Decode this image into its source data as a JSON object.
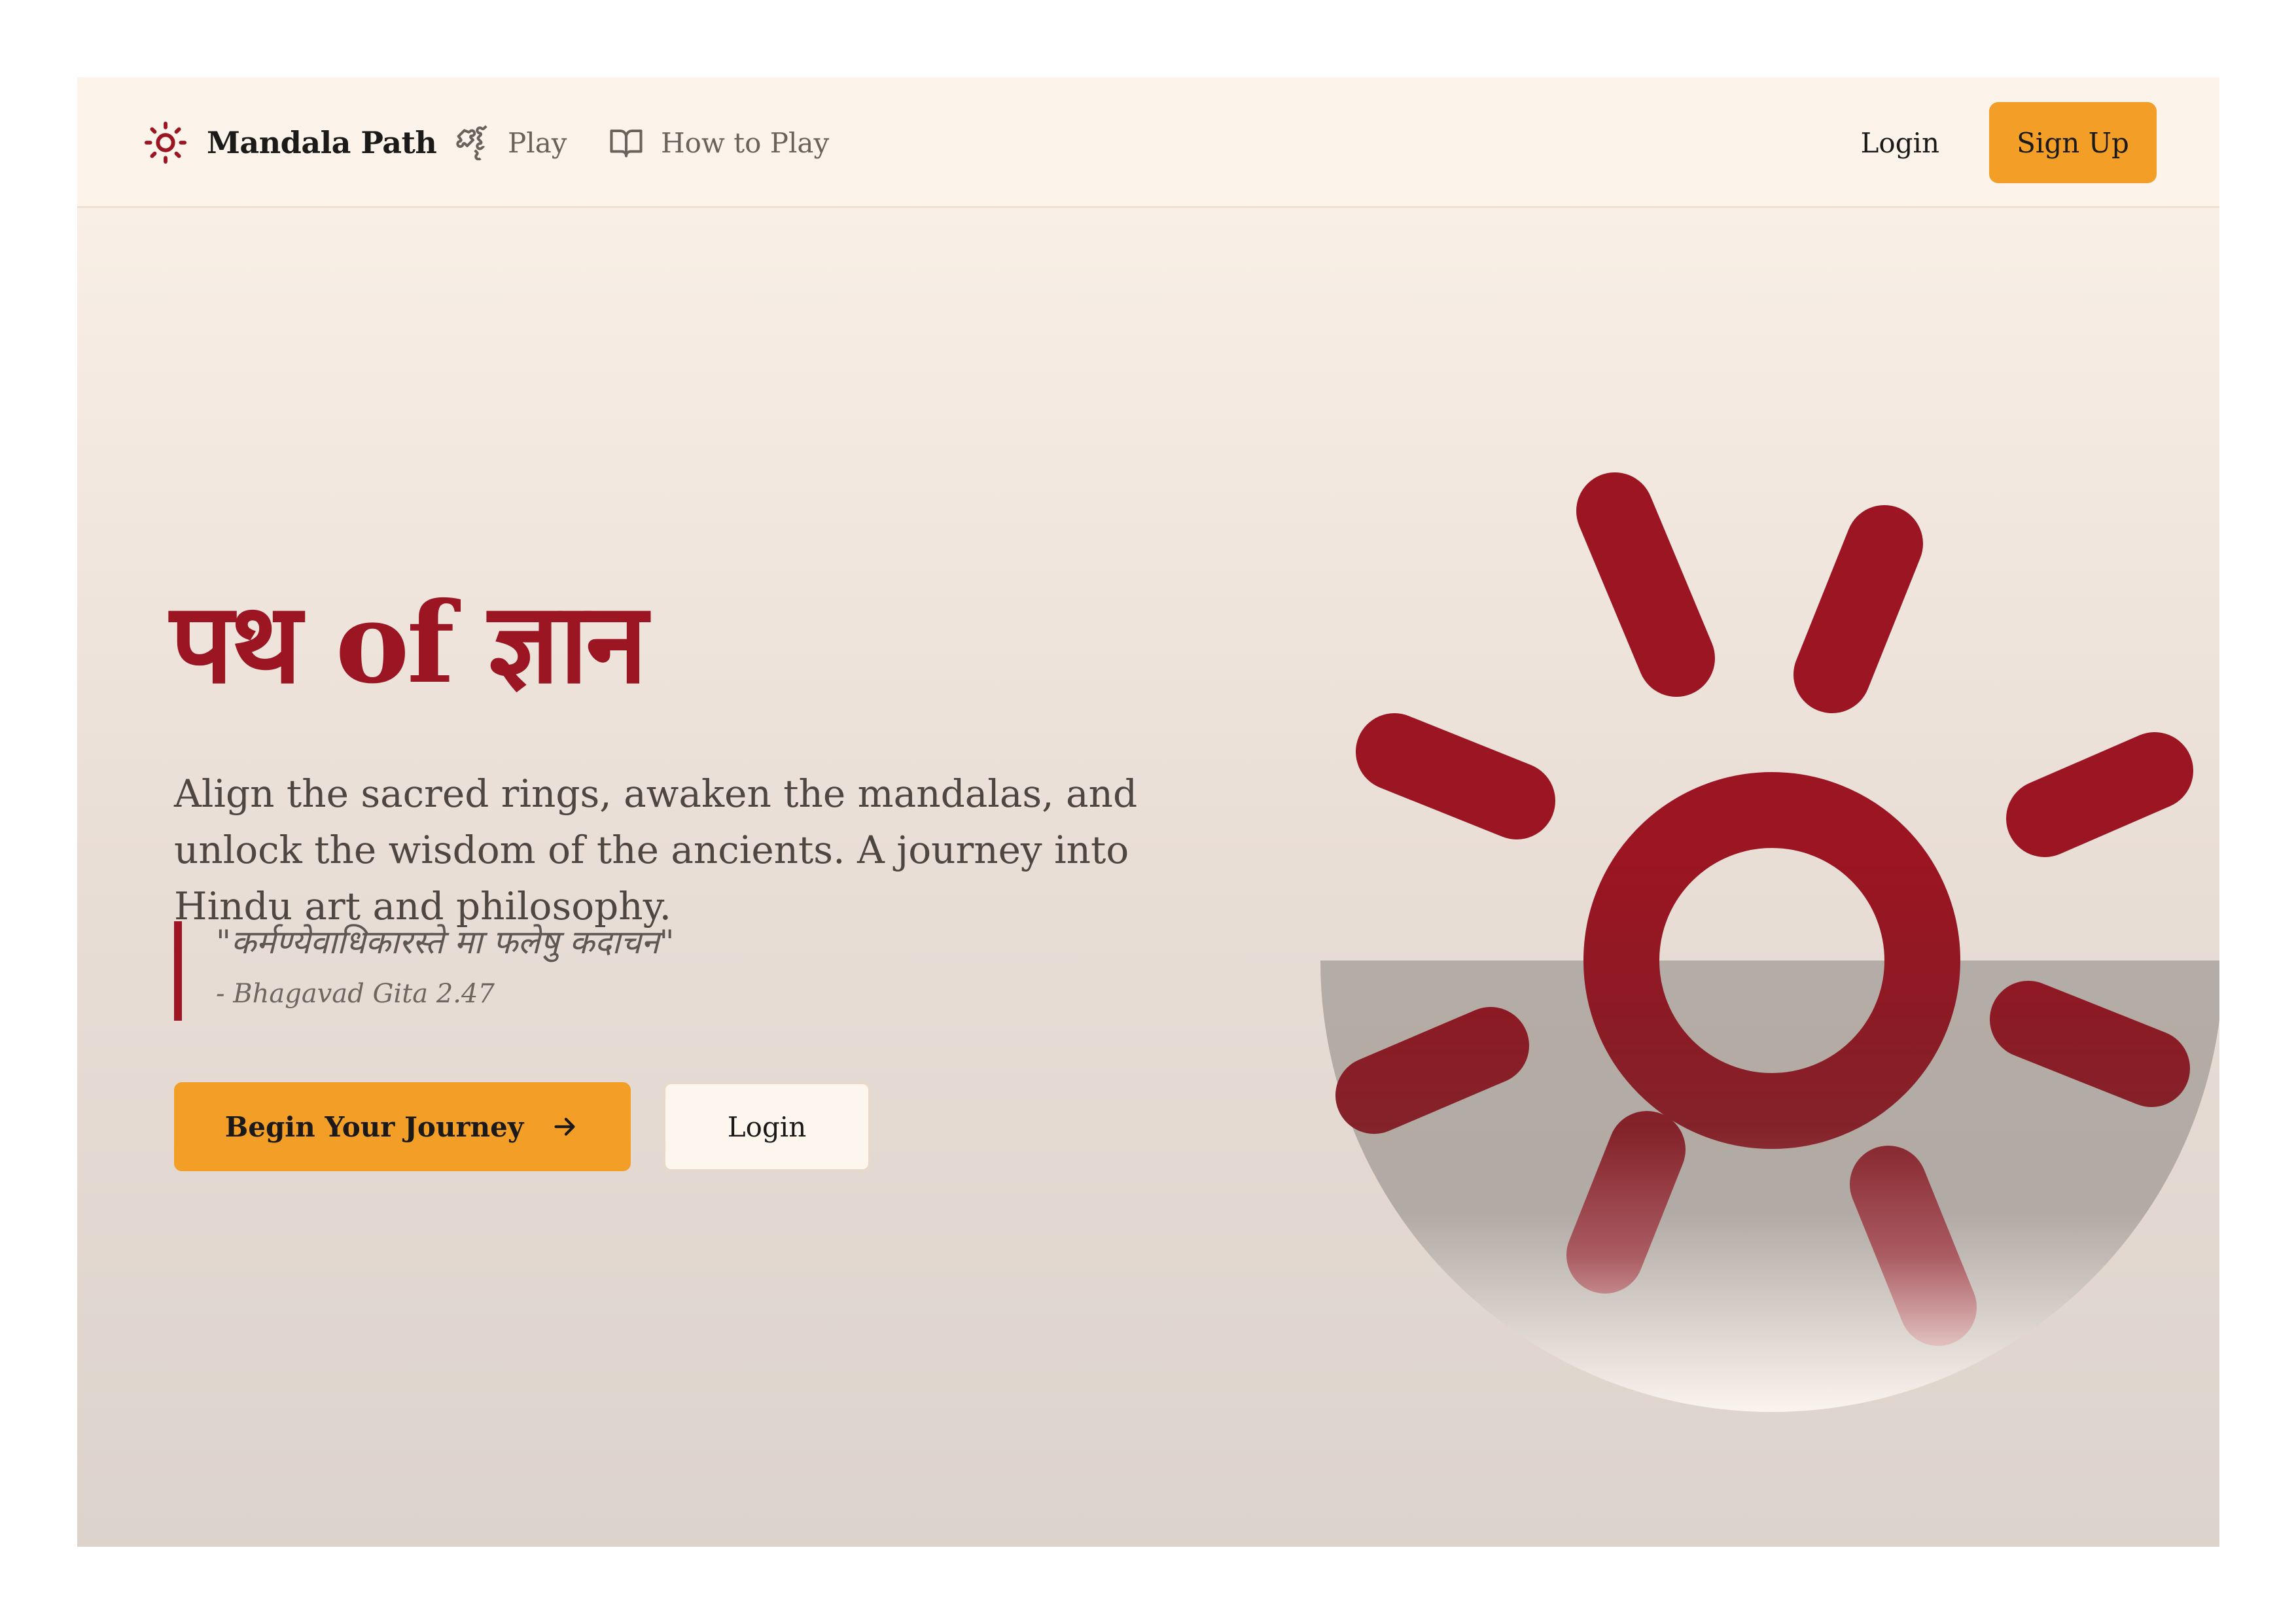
{
  "nav": {
    "brand": "Mandala Path",
    "links": [
      {
        "label": "Play",
        "icon": "puzzle-icon"
      },
      {
        "label": "How to Play",
        "icon": "book-icon"
      }
    ],
    "login_label": "Login",
    "signup_label": "Sign Up"
  },
  "hero": {
    "title": "पथ of ज्ञान",
    "subtitle": "Align the sacred rings, awaken the mandalas, and unlock the wisdom of the ancients. A journey into Hindu art and philosophy.",
    "quote": "\"कर्मण्येवाधिकारस्ते मा फलेषु कदाचन\"",
    "quote_source": "- Bhagavad Gita 2.47",
    "primary_button": "Begin Your Journey",
    "secondary_button": "Login",
    "graphic_icon": "sun-icon"
  },
  "colors": {
    "accent": "#f29e27",
    "brand_red": "#9b1522",
    "background": "#fcf3ea"
  }
}
